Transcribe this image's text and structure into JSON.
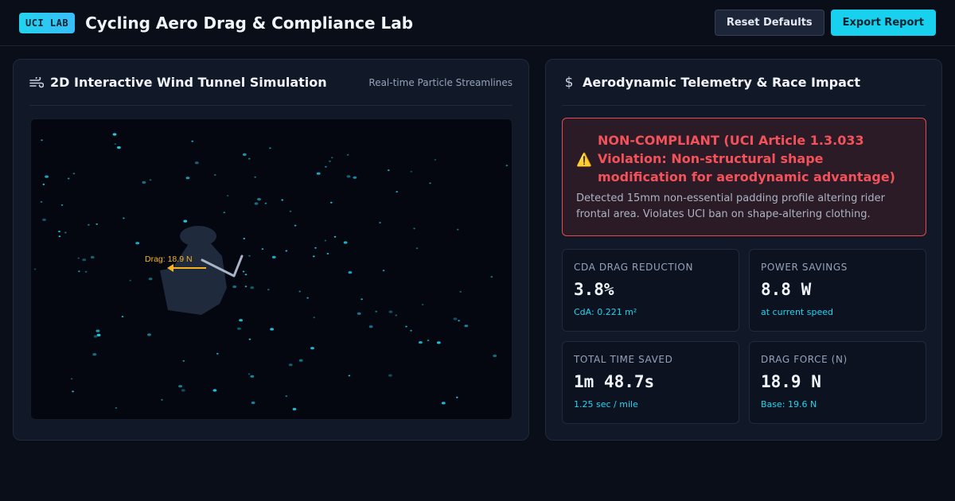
{
  "header": {
    "badge": "UCI LAB",
    "title": "Cycling Aero Drag & Compliance Lab",
    "reset_label": "Reset Defaults",
    "export_label": "Export Report"
  },
  "simulation": {
    "icon": "wind-icon",
    "title": "2D Interactive Wind Tunnel Simulation",
    "subtitle": "Real-time Particle Streamlines",
    "drag_label": "Drag: 18.9 N"
  },
  "telemetry": {
    "icon": "dollar-icon",
    "title": "Aerodynamic Telemetry & Race Impact",
    "alert": {
      "icon": "warning-icon",
      "title": "NON-COMPLIANT (UCI Article 1.3.033 Violation: Non-structural shape modification for aerodynamic advantage)",
      "description": "Detected 15mm non-essential padding profile altering rider frontal area. Violates UCI ban on shape-altering clothing."
    },
    "metrics": [
      {
        "label": "CDA DRAG REDUCTION",
        "value": "3.8%",
        "sub": "CdA: 0.221 m²"
      },
      {
        "label": "POWER SAVINGS",
        "value": "8.8 W",
        "sub": "at current speed"
      },
      {
        "label": "TOTAL TIME SAVED",
        "value": "1m 48.7s",
        "sub": "1.25 sec / mile"
      },
      {
        "label": "DRAG FORCE (N)",
        "value": "18.9 N",
        "sub": "Base: 19.6 N"
      }
    ]
  },
  "colors": {
    "accent": "#22d3ee",
    "alert": "#f3525a",
    "drag_arrow": "#f5b324"
  }
}
